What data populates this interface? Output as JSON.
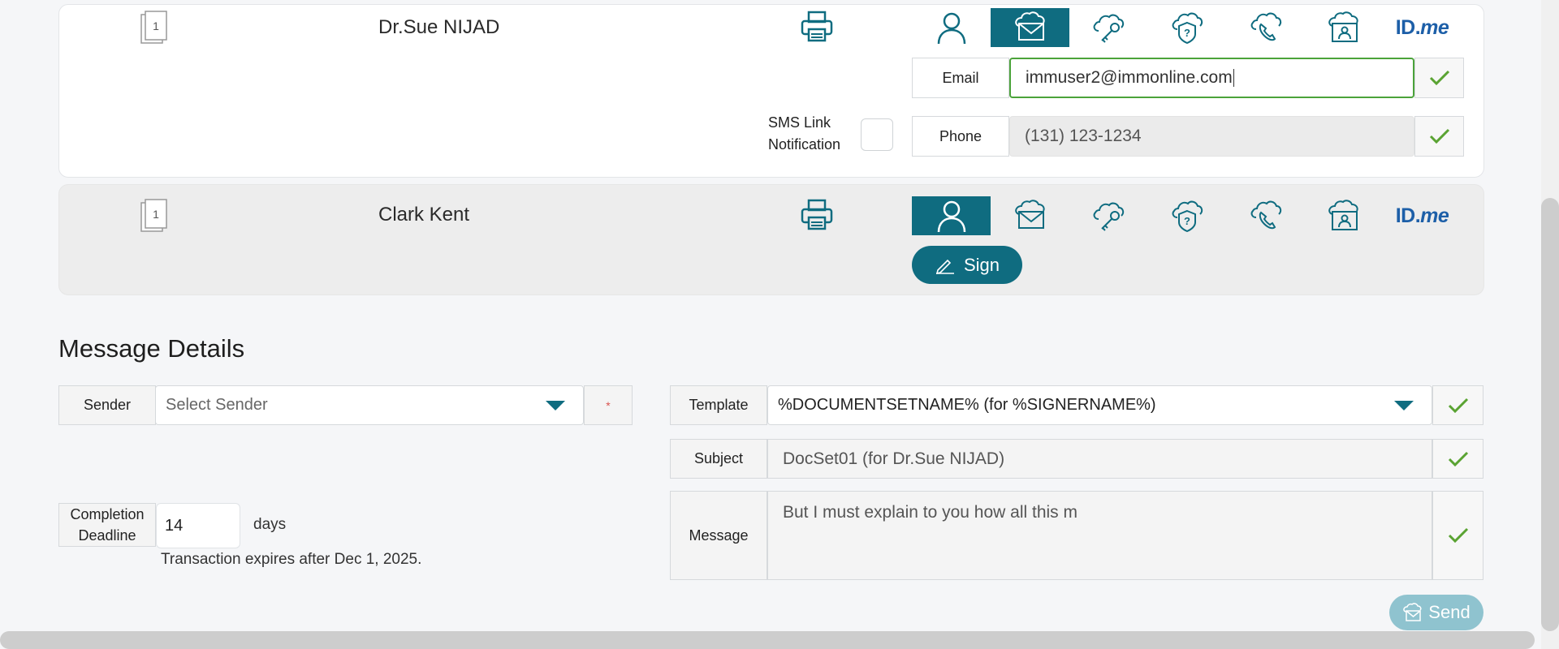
{
  "signers": [
    {
      "name": "Dr.Sue NIJAD",
      "doc_count": "1",
      "active_auth": "email",
      "email_label": "Email",
      "email_value": "immuser2@immonline.com",
      "sms_label_line1": "SMS Link",
      "sms_label_line2": "Notification",
      "phone_label": "Phone",
      "phone_value": "(131) 123-1234"
    },
    {
      "name": "Clark Kent",
      "doc_count": "1",
      "active_auth": "user",
      "sign_label": "Sign"
    }
  ],
  "auth_methods": [
    "user-icon",
    "email-cloud-icon",
    "cloud-key-icon",
    "cloud-question-icon",
    "cloud-phone-icon",
    "id-card-icon",
    "idme-logo"
  ],
  "idme_text": {
    "id": "ID.",
    "me": "me"
  },
  "message_details": {
    "title": "Message Details",
    "sender_label": "Sender",
    "sender_placeholder": "Select Sender",
    "required_mark": "*",
    "template_label": "Template",
    "template_value": "%DOCUMENTSETNAME% (for %SIGNERNAME%)",
    "subject_label": "Subject",
    "subject_value": "DocSet01 (for Dr.Sue NIJAD)",
    "message_label": "Message",
    "message_value": "But I must explain to you how all this m",
    "deadline_label_line1": "Completion",
    "deadline_label_line2": "Deadline",
    "deadline_value": "14",
    "deadline_unit": "days",
    "expiry_text": "Transaction expires after Dec 1, 2025.",
    "send_label": "Send"
  },
  "colors": {
    "accent": "#0f6c80",
    "check": "#5aa332",
    "send_disabled": "#8fc3cf"
  }
}
